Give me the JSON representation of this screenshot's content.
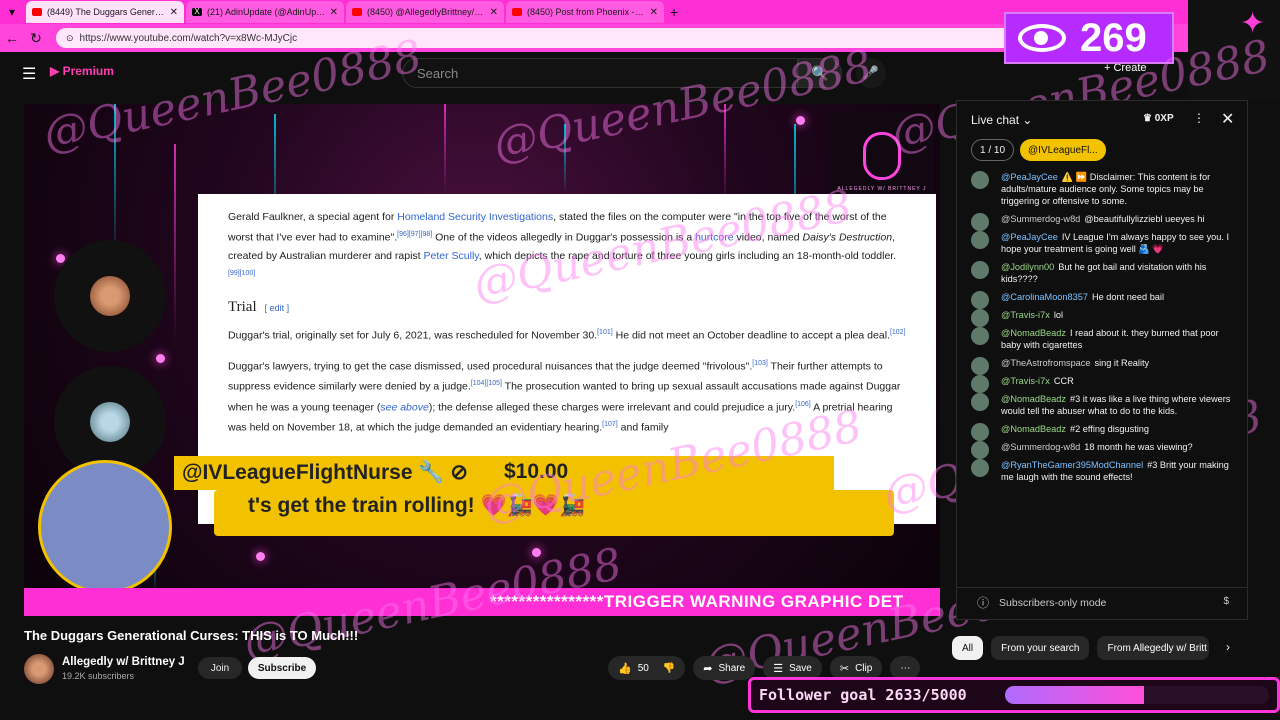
{
  "browser": {
    "tabs": [
      {
        "title": "(8449) The Duggars Generational",
        "active": true,
        "favicon": "youtube-icon"
      },
      {
        "title": "(21) AdinUpdate (@AdinUpdate) /",
        "active": false,
        "favicon": "x-icon"
      },
      {
        "title": "(8450) @AllegedlyBrittney/ can nc",
        "active": false,
        "favicon": "youtube-icon"
      },
      {
        "title": "(8450) Post from Phoenix - YouTub",
        "active": false,
        "favicon": "youtube-icon"
      }
    ],
    "url": "https://www.youtube.com/watch?v=x8Wc-MJyCjc"
  },
  "overlay": {
    "viewer_count": "269",
    "watermark": "@QueenBee0888",
    "follower_goal": "Follower goal 2633/5000",
    "follower_goal_progress": 0.527
  },
  "header": {
    "search_placeholder": "Search",
    "create_label": "Create"
  },
  "video": {
    "wiki": {
      "para1_a": "Gerald Faulkner, a special agent for ",
      "para1_link": "Homeland Security Investigations",
      "para1_b": ", stated the files on the computer were \"in the top five of the worst of the worst that I've ever had to examine\".",
      "para1_sup": "[96][97][98]",
      "para1_c": " One of the videos allegedly in Duggar's possession is a ",
      "para1_link2": "hurtcore",
      "para1_d": " video, named ",
      "para1_italic": "Daisy's Destruction",
      "para1_e": ", created by Australian murderer and rapist ",
      "para1_link3": "Peter Scully",
      "para1_f": ", which depicts the rape and torture of three young girls including an 18-month-old toddler.",
      "para1_sup2": "[99][100]",
      "heading": "Trial",
      "edit": "[ edit ]",
      "para2": "Duggar's trial, originally set for July 6, 2021, was rescheduled for November 30.",
      "para2_sup": "[101]",
      "para2_b": " He did not meet an October deadline to accept a plea deal.",
      "para2_sup2": "[102]",
      "para3": "Duggar's lawyers, trying to get the case dismissed, used procedural nuisances that the judge deemed \"frivolous\".",
      "para3_sup": "[103]",
      "para3_b": " Their further attempts to suppress evidence similarly were denied by a judge.",
      "para3_sup2": "[104][105]",
      "para3_c": " The prosecution wanted to bring up sexual assault accusations made against Duggar when he was a young teenager (",
      "para3_see": "see above",
      "para3_d": "); the defense alleged these charges were irrelevant and could prejudice a jury.",
      "para3_sup3": "[106]",
      "para3_e": " A pretrial hearing was held on November 18, at which the judge demanded an evidentiary hearing.",
      "para3_sup4": "[107]",
      "para3_tail": "and family"
    },
    "mic_logo_label": "ALLEGEDLY W/ BRITTNEY J",
    "donation_name": "@IVLeagueFlightNurse 🔧 ⊘",
    "donation_amount": "$10.00",
    "donation_message": "t's get the train rolling! 💗🚂💗🚂",
    "warning_banner": "****************TRIGGER WARNING GRAPHIC DET",
    "title": "The Duggars Generational Curses: THIS is TO Much!!!",
    "channel_name": "Allegedly w/ Brittney J",
    "channel_subs": "19.2K subscribers",
    "join_label": "Join",
    "subscribe_label": "Subscribe",
    "likes": "50",
    "share_label": "Share",
    "save_label": "Save",
    "clip_label": "Clip"
  },
  "chat": {
    "title": "Live chat",
    "xp": "0XP",
    "count_chip": "1 / 10",
    "user_chip": "@IVLeagueFl...",
    "messages": [
      {
        "author": "@PeaJayCee",
        "text": "⚠️ ⏩ Disclaimer: This content is for adults/mature audience only. Some topics may be triggering or offensive to some."
      },
      {
        "author": "@Summerdog-w8d",
        "text": "@beautifullylizziebl ueeyes hi"
      },
      {
        "author": "@PeaJayCee",
        "text": "IV League I'm always happy to see you. I hope your treatment is going well 🫂 💗"
      },
      {
        "author": "@Jodilynn00",
        "text": "But he got bail and visitation with his kids????"
      },
      {
        "author": "@CarolinaMoon8357",
        "text": "He dont need bail"
      },
      {
        "author": "@Travis-i7x",
        "text": "lol"
      },
      {
        "author": "@NomadBeadz",
        "text": "I read about it. they burned that poor baby with cigarettes"
      },
      {
        "author": "@TheAstrofromspace",
        "text": "sing it Reality"
      },
      {
        "author": "@Travis-i7x",
        "text": "CCR"
      },
      {
        "author": "@NomadBeadz",
        "text": "#3 it was like a live thing where viewers would tell the abuser what to do to the kids."
      },
      {
        "author": "@NomadBeadz",
        "text": "#2 effing disgusting"
      },
      {
        "author": "@Summerdog-w8d",
        "text": "18 month he was viewing?"
      },
      {
        "author": "@RyanTheGamer395ModChannel",
        "text": "#3 Britt your making me laugh with the sound effects!"
      }
    ],
    "footer": "Subscribers-only mode",
    "filters": [
      "All",
      "From your search",
      "From Allegedly w/ Britt"
    ]
  }
}
